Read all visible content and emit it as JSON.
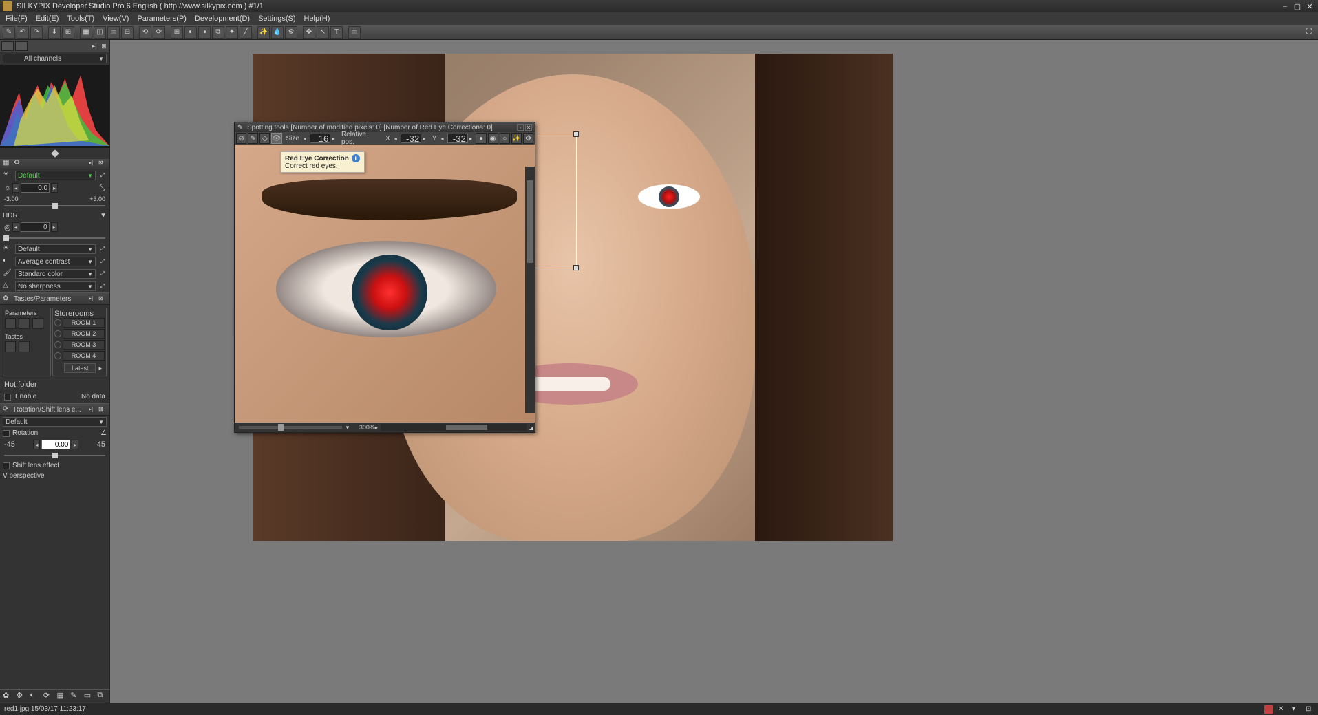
{
  "title": "SILKYPIX Developer Studio Pro 6 English ( http://www.silkypix.com )   #1/1",
  "menu": {
    "file": "File(F)",
    "edit": "Edit(E)",
    "tools": "Tools(T)",
    "view": "View(V)",
    "parameters": "Parameters(P)",
    "development": "Development(D)",
    "settings": "Settings(S)",
    "help": "Help(H)"
  },
  "channels_label": "All channels",
  "exposure": {
    "preset": "Default",
    "value": "0.0",
    "min": "-3.00",
    "max": "+3.00"
  },
  "hdr": {
    "label": "HDR",
    "value": "0"
  },
  "wb": {
    "preset": "Default"
  },
  "tone": {
    "preset": "Average contrast"
  },
  "color": {
    "preset": "Standard color"
  },
  "sharp": {
    "preset": "No sharpness"
  },
  "tastes": {
    "header": "Tastes/Parameters",
    "params_legend": "Parameters",
    "rooms_legend": "Storerooms",
    "tastes_legend": "Tastes",
    "rooms": [
      "ROOM 1",
      "ROOM 2",
      "ROOM 3",
      "ROOM 4"
    ],
    "latest": "Latest"
  },
  "hotfolder": {
    "legend": "Hot folder",
    "enable": "Enable",
    "nodata": "No data"
  },
  "rotation": {
    "header": "Rotation/Shift lens e...",
    "preset": "Default",
    "rotation_cb": "Rotation",
    "rotation_val": "0.00",
    "rotation_min": "-45",
    "rotation_max": "45",
    "shift_cb": "Shift lens effect",
    "vpersp": "V perspective"
  },
  "spotting": {
    "title": "Spotting tools [Number of modified pixels: 0]  [Number of Red Eye Corrections: 0]",
    "size_label": "Size",
    "size_val": "16",
    "relpos_label": "Relative pos.",
    "x_label": "X",
    "x_val": "-32",
    "y_label": "Y",
    "y_val": "-32",
    "zoom_val": "300",
    "zoom_pct": "%"
  },
  "tooltip": {
    "title": "Red Eye Correction",
    "body": "Correct red eyes."
  },
  "status": {
    "filename": "red1.jpg",
    "date": "15/03/17",
    "time": "11:23:17"
  }
}
